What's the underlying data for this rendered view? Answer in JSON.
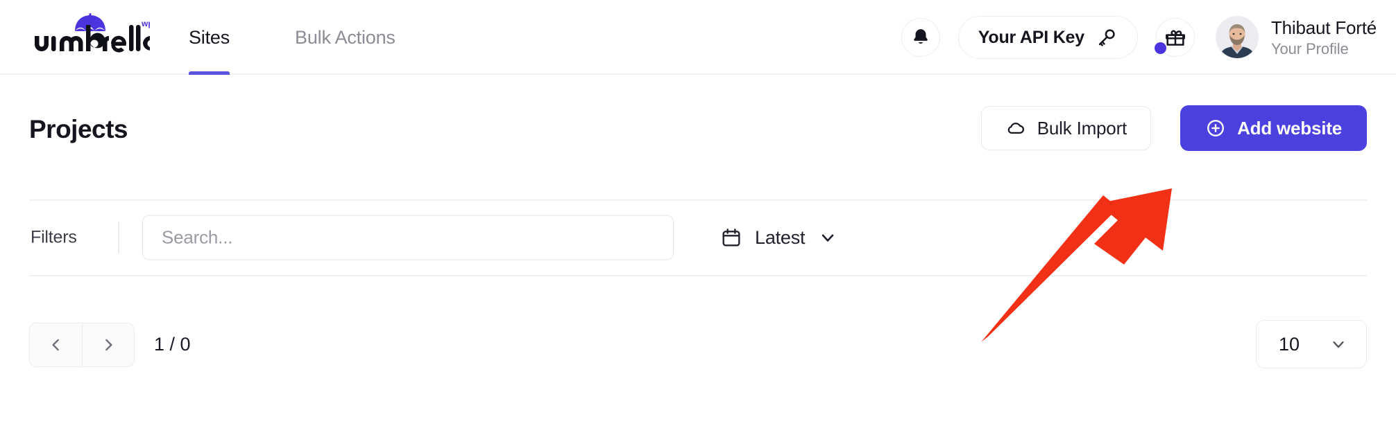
{
  "brand": {
    "logo_text": "umbrella",
    "logo_superscript": "wp",
    "accent_color": "#4b41de",
    "umbrella_color": "#4b33dd"
  },
  "header": {
    "nav": [
      {
        "label": "Sites",
        "active": true
      },
      {
        "label": "Bulk Actions",
        "active": false
      }
    ],
    "notifications_icon": "bell-icon",
    "api_key": {
      "label": "Your API Key",
      "icon": "key-icon"
    },
    "gift": {
      "icon": "gift-icon",
      "has_badge": true,
      "badge_color": "#4b33dd"
    },
    "profile": {
      "name": "Thibaut Forté",
      "subtitle": "Your Profile",
      "avatar_icon": "user-avatar"
    }
  },
  "page": {
    "title": "Projects",
    "actions": {
      "bulk_import": {
        "label": "Bulk Import",
        "icon": "cloud-icon"
      },
      "add_website": {
        "label": "Add website",
        "icon": "plus-circle-icon"
      }
    }
  },
  "filters": {
    "label": "Filters",
    "search": {
      "value": "",
      "placeholder": "Search..."
    },
    "sort": {
      "label": "Latest",
      "icon": "calendar-icon",
      "chevron": "chevron-down-icon"
    }
  },
  "pagination": {
    "prev_icon": "chevron-left-icon",
    "next_icon": "chevron-right-icon",
    "count_text": "1 / 0",
    "per_page": {
      "value": "10",
      "chevron": "chevron-down-icon"
    }
  },
  "annotation": {
    "type": "arrow",
    "color": "#f23015",
    "points_to": "add-website-button"
  }
}
